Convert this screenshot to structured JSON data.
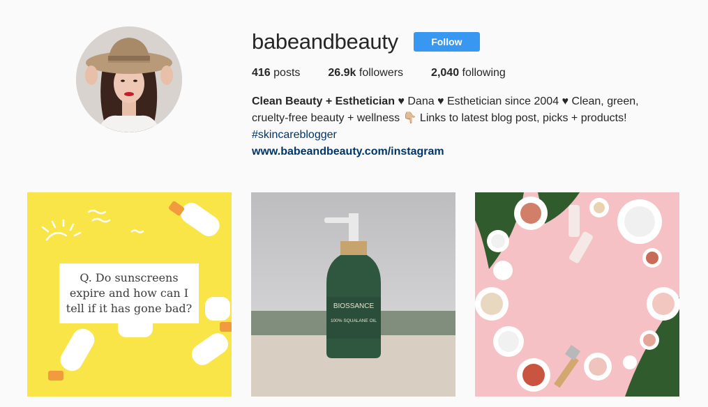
{
  "profile": {
    "username": "babeandbeauty",
    "follow_label": "Follow",
    "stats": {
      "posts_count": "416",
      "posts_label": "posts",
      "followers_count": "26.9k",
      "followers_label": "followers",
      "following_count": "2,040",
      "following_label": "following"
    },
    "bio": {
      "name": "Clean Beauty + Esthetician",
      "line1_rest": " ♥ Dana ♥ Esthetician since 2004 ♥ Clean, green,",
      "line2": "cruelty-free beauty + wellness 👇🏼 Links to latest blog post, picks + products!",
      "hashtag": "#skincareblogger",
      "website": "www.babeandbeauty.com/instagram"
    }
  },
  "posts": [
    {
      "caption_text": "Q. Do sunscreens expire and how can I tell if it has gone bad?"
    },
    {
      "bottle_brand": "BIOSSANCE",
      "bottle_product": "100% SQUALANE OIL"
    },
    {}
  ],
  "colors": {
    "follow_button": "#3897f0",
    "link": "#003569",
    "post1_bg": "#f9e548",
    "post3_bg": "#f6c1c4"
  }
}
